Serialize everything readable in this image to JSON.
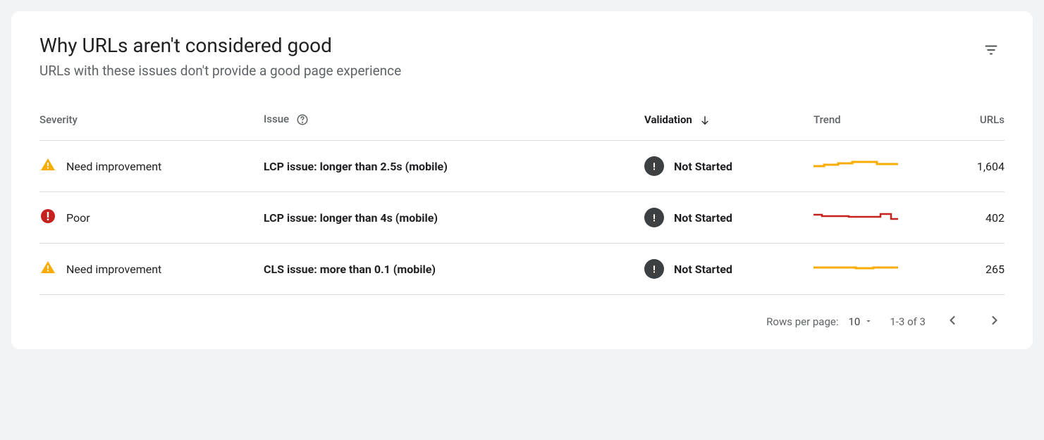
{
  "header": {
    "title": "Why URLs aren't considered good",
    "subtitle": "URLs with these issues don't provide a good page experience"
  },
  "table": {
    "columns": {
      "severity": "Severity",
      "issue": "Issue",
      "validation": "Validation",
      "trend": "Trend",
      "urls": "URLs"
    },
    "rows": [
      {
        "severity": "Need improvement",
        "severity_type": "warning",
        "issue": "LCP issue: longer than 2.5s (mobile)",
        "validation": "Not Started",
        "trend_color": "#f9ab00",
        "urls": "1,604"
      },
      {
        "severity": "Poor",
        "severity_type": "error",
        "issue": "LCP issue: longer than 4s (mobile)",
        "validation": "Not Started",
        "trend_color": "#c5221f",
        "urls": "402"
      },
      {
        "severity": "Need improvement",
        "severity_type": "warning",
        "issue": "CLS issue: more than 0.1 (mobile)",
        "validation": "Not Started",
        "trend_color": "#f9ab00",
        "urls": "265"
      }
    ]
  },
  "pagination": {
    "rows_label": "Rows per page:",
    "page_size": "10",
    "range": "1-3 of 3"
  }
}
